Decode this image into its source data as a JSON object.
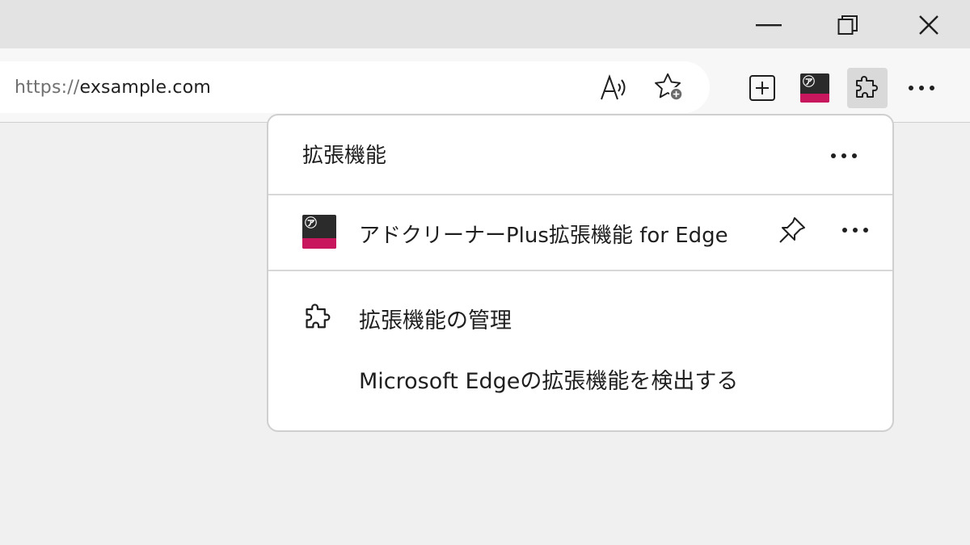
{
  "window": {
    "minimize_icon": "minimize-icon",
    "restore_icon": "restore-icon",
    "close_icon": "close-icon"
  },
  "address_bar": {
    "url_protocol": "https://",
    "url_host": "exsample.com",
    "read_aloud_icon": "read-aloud-icon",
    "add_favorite_icon": "star-add-icon"
  },
  "toolbar": {
    "collections_icon": "add-tab-icon",
    "extension_icon": "adcleaner-logo-icon",
    "extensions_icon": "puzzle-icon",
    "more_icon": "more-horizontal-icon"
  },
  "extensions_panel": {
    "title": "拡張機能",
    "more_icon": "more-horizontal-icon",
    "items": [
      {
        "name": "アドクリーナーPlus拡張機能 for Edge",
        "logo_icon": "adcleaner-logo-icon",
        "pin_icon": "pin-icon",
        "more_icon": "more-horizontal-icon"
      }
    ],
    "manage_label": "拡張機能の管理",
    "manage_icon": "puzzle-icon",
    "discover_label": "Microsoft Edgeの拡張機能を検出する"
  },
  "colors": {
    "titlebar": "#e3e3e3",
    "page_background": "#f0f0f0",
    "logo_accent": "#c8175d"
  }
}
